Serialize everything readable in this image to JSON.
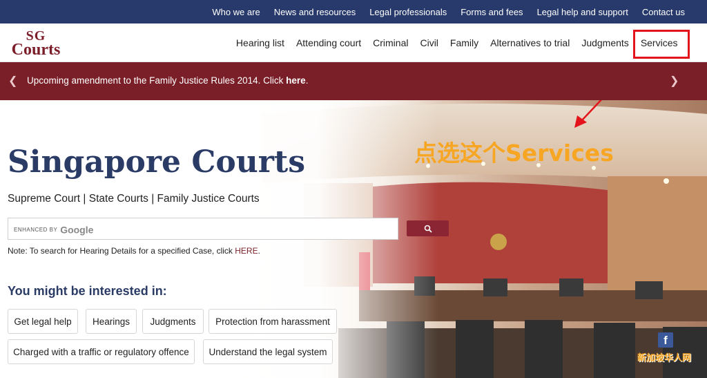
{
  "topbar": {
    "links": [
      "Who we are",
      "News and resources",
      "Legal professionals",
      "Forms and fees",
      "Legal help and support",
      "Contact us"
    ]
  },
  "logo": {
    "line1": "SG",
    "line2": "Courts"
  },
  "nav": {
    "items": [
      "Hearing list",
      "Attending court",
      "Criminal",
      "Civil",
      "Family",
      "Alternatives to trial",
      "Judgments",
      "Services"
    ]
  },
  "announcement": {
    "text": "Upcoming amendment to the Family Justice Rules 2014. Click ",
    "link": "here",
    "suffix": "."
  },
  "hero": {
    "title": "Singapore Courts",
    "subtitle": "Supreme Court | State Courts | Family Justice Courts",
    "search": {
      "prefix": "ENHANCED BY",
      "brand": "Google"
    },
    "note": {
      "text": "Note: To search for Hearing Details for a specified Case, click ",
      "link": "HERE",
      "suffix": "."
    },
    "interest_heading": "You might be interested in:",
    "chips": [
      "Get legal help",
      "Hearings",
      "Judgments",
      "Protection from harassment",
      "Charged with a traffic or regulatory offence",
      "Understand the legal system"
    ]
  },
  "annotation": {
    "text": "点选这个Services",
    "color": "#f6a623",
    "box_color": "#e3141b"
  },
  "watermark": "新加坡华人网",
  "colors": {
    "navy": "#273a6b",
    "maroon": "#7a1f28",
    "title": "#2a3b66"
  }
}
